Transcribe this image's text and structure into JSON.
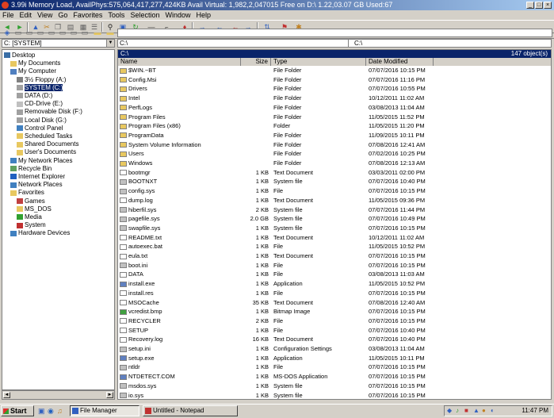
{
  "window": {
    "title": "3.99i Memory Load, AvailPhys:575,064,417,277,424KB Avail Virtual: 1,982,2,047015 Free on D:\\ 1.22,03.07 GB Used:67"
  },
  "menu": [
    "File",
    "Edit",
    "View",
    "Go",
    "Favorites",
    "Tools",
    "Selection",
    "Window",
    "Help"
  ],
  "drive_selector": {
    "value": "C: [SYSTEM]"
  },
  "path": {
    "left": "C:\\",
    "right": "C:\\"
  },
  "list_header": {
    "title": "C:\\",
    "count": "147 object(s)"
  },
  "columns": [
    "Name",
    "Size",
    "Type",
    "Date Modified"
  ],
  "tree": [
    {
      "label": "Desktop",
      "level": 0,
      "icon": "desktop-icon",
      "color": "#3a6ea5"
    },
    {
      "label": "My Documents",
      "level": 1,
      "icon": "folder-icon",
      "color": "#e8c860"
    },
    {
      "label": "My Computer",
      "level": 1,
      "icon": "computer-icon",
      "color": "#5080c0"
    },
    {
      "label": "3½ Floppy (A:)",
      "level": 2,
      "icon": "floppy-icon",
      "color": "#808080"
    },
    {
      "label": "SYSTEM (C:)",
      "level": 2,
      "icon": "drive-icon",
      "color": "#a0a0a0"
    },
    {
      "label": "DATA (D:)",
      "level": 2,
      "icon": "drive-icon",
      "color": "#a0a0a0"
    },
    {
      "label": "CD-Drive (E:)",
      "level": 2,
      "icon": "cd-drive-icon",
      "color": "#c0c0c0"
    },
    {
      "label": "Removable Disk (F:)",
      "level": 2,
      "icon": "drive-icon",
      "color": "#a0a0a0"
    },
    {
      "label": "Local Disk (G:)",
      "level": 2,
      "icon": "drive-icon",
      "color": "#a0a0a0"
    },
    {
      "label": "Control Panel",
      "level": 2,
      "icon": "control-panel-icon",
      "color": "#4080c0"
    },
    {
      "label": "Scheduled Tasks",
      "level": 2,
      "icon": "tasks-icon",
      "color": "#e8c860"
    },
    {
      "label": "Shared Documents",
      "level": 2,
      "icon": "folder-icon",
      "color": "#e8c860"
    },
    {
      "label": "User's Documents",
      "level": 2,
      "icon": "folder-icon",
      "color": "#e8c860"
    },
    {
      "label": "My Network Places",
      "level": 1,
      "icon": "network-icon",
      "color": "#4080c0"
    },
    {
      "label": "Recycle Bin",
      "level": 1,
      "icon": "recycle-bin-icon",
      "color": "#60a060"
    },
    {
      "label": "Internet Explorer",
      "level": 1,
      "icon": "ie-icon",
      "color": "#2060c0"
    },
    {
      "label": "Network Places",
      "level": 1,
      "icon": "network-icon",
      "color": "#4080c0"
    },
    {
      "label": "Favorites",
      "level": 1,
      "icon": "favorites-icon",
      "color": "#e8c860"
    },
    {
      "label": "Games",
      "level": 2,
      "icon": "games-icon",
      "color": "#c04040"
    },
    {
      "label": "MS_DOS",
      "level": 2,
      "icon": "folder-icon",
      "color": "#e8c860"
    },
    {
      "label": "Media",
      "level": 2,
      "icon": "media-icon",
      "color": "#30a030"
    },
    {
      "label": "System",
      "level": 2,
      "icon": "system-icon",
      "color": "#c03030"
    },
    {
      "label": "Hardware Devices",
      "level": 1,
      "icon": "hardware-icon",
      "color": "#4080c0"
    }
  ],
  "files": [
    {
      "name": "$WIN.~BT",
      "size": "",
      "type": "File Folder",
      "date": "07/07/2016 10:15 PM",
      "icon": "folder-icon",
      "color": "#e8c860"
    },
    {
      "name": "Config.Msi",
      "size": "",
      "type": "File Folder",
      "date": "07/07/2016 11:16 PM",
      "icon": "folder-icon",
      "color": "#e8c860"
    },
    {
      "name": "Drivers",
      "size": "",
      "type": "File Folder",
      "date": "07/07/2016 10:55 PM",
      "icon": "folder-icon",
      "color": "#e8c860"
    },
    {
      "name": "Intel",
      "size": "",
      "type": "File Folder",
      "date": "10/12/2011 11:02 AM",
      "icon": "folder-icon",
      "color": "#e8c860"
    },
    {
      "name": "PerfLogs",
      "size": "",
      "type": "File Folder",
      "date": "03/08/2013 11:04 AM",
      "icon": "folder-icon",
      "color": "#e8c860"
    },
    {
      "name": "Program Files",
      "size": "",
      "type": "File Folder",
      "date": "11/05/2015 11:52 PM",
      "icon": "folder-icon",
      "color": "#e8c860"
    },
    {
      "name": "Program Files (x86)",
      "size": "",
      "type": "Folder",
      "date": "11/05/2015 11:20 PM",
      "icon": "folder-icon",
      "color": "#e8c860"
    },
    {
      "name": "ProgramData",
      "size": "",
      "type": "File Folder",
      "date": "11/09/2015 10:11 PM",
      "icon": "folder-icon",
      "color": "#e8c860"
    },
    {
      "name": "System Volume Information",
      "size": "",
      "type": "File Folder",
      "date": "07/08/2016 12:41 AM",
      "icon": "folder-icon",
      "color": "#e8c860"
    },
    {
      "name": "Users",
      "size": "",
      "type": "File Folder",
      "date": "07/02/2016 10:25 PM",
      "icon": "folder-icon",
      "color": "#e8c860"
    },
    {
      "name": "Windows",
      "size": "",
      "type": "File Folder",
      "date": "07/08/2016 12:13 AM",
      "icon": "folder-icon",
      "color": "#e8c860"
    },
    {
      "name": "bootmgr",
      "size": "1 KB",
      "type": "Text Document",
      "date": "03/03/2011 02:00 PM",
      "icon": "file-icon",
      "color": "#ffffff"
    },
    {
      "name": "BOOTNXT",
      "size": "1 KB",
      "type": "System file",
      "date": "07/07/2016 10:40 PM",
      "icon": "sysfile-icon",
      "color": "#c0c0c0"
    },
    {
      "name": "config.sys",
      "size": "1 KB",
      "type": "File",
      "date": "07/07/2016 10:15 PM",
      "icon": "sysfile-icon",
      "color": "#c0c0c0"
    },
    {
      "name": "dump.log",
      "size": "1 KB",
      "type": "Text Document",
      "date": "11/05/2015 09:36 PM",
      "icon": "file-icon",
      "color": "#ffffff"
    },
    {
      "name": "hiberfil.sys",
      "size": "2 KB",
      "type": "System file",
      "date": "07/07/2016 11:44 PM",
      "icon": "sysfile-icon",
      "color": "#c0c0c0"
    },
    {
      "name": "pagefile.sys",
      "size": "2.0 GB",
      "type": "System file",
      "date": "07/07/2016 10:49 PM",
      "icon": "sysfile-icon",
      "color": "#c0c0c0"
    },
    {
      "name": "swapfile.sys",
      "size": "1 KB",
      "type": "System file",
      "date": "07/07/2016 10:15 PM",
      "icon": "sysfile-icon",
      "color": "#c0c0c0"
    },
    {
      "name": "README.txt",
      "size": "1 KB",
      "type": "Text Document",
      "date": "10/12/2011 11:02 AM",
      "icon": "file-icon",
      "color": "#ffffff"
    },
    {
      "name": "autoexec.bat",
      "size": "1 KB",
      "type": "File",
      "date": "11/05/2015 10:52 PM",
      "icon": "file-icon",
      "color": "#ffffff"
    },
    {
      "name": "eula.txt",
      "size": "1 KB",
      "type": "Text Document",
      "date": "07/07/2016 10:15 PM",
      "icon": "file-icon",
      "color": "#ffffff"
    },
    {
      "name": "boot.ini",
      "size": "1 KB",
      "type": "File",
      "date": "07/07/2016 10:15 PM",
      "icon": "sysfile-icon",
      "color": "#c0c0c0"
    },
    {
      "name": "DATA",
      "size": "1 KB",
      "type": "File",
      "date": "03/08/2013 11:03 AM",
      "icon": "file-icon",
      "color": "#ffffff"
    },
    {
      "name": "install.exe",
      "size": "1 KB",
      "type": "Application",
      "date": "11/05/2015 10:52 PM",
      "icon": "exe-icon",
      "color": "#6080c0"
    },
    {
      "name": "install.res",
      "size": "1 KB",
      "type": "File",
      "date": "07/07/2016 10:15 PM",
      "icon": "file-icon",
      "color": "#ffffff"
    },
    {
      "name": "MSOCache",
      "size": "35 KB",
      "type": "Text Document",
      "date": "07/08/2016 12:40 AM",
      "icon": "file-icon",
      "color": "#ffffff"
    },
    {
      "name": "vcredist.bmp",
      "size": "1 KB",
      "type": "Bitmap Image",
      "date": "07/07/2016 10:15 PM",
      "icon": "image-icon",
      "color": "#40a040"
    },
    {
      "name": "RECYCLER",
      "size": "2 KB",
      "type": "File",
      "date": "07/07/2016 10:15 PM",
      "icon": "file-icon",
      "color": "#ffffff"
    },
    {
      "name": "SETUP",
      "size": "1 KB",
      "type": "File",
      "date": "07/07/2016 10:40 PM",
      "icon": "file-icon",
      "color": "#ffffff"
    },
    {
      "name": "Recovery.log",
      "size": "16 KB",
      "type": "Text Document",
      "date": "07/07/2016 10:40 PM",
      "icon": "file-icon",
      "color": "#ffffff"
    },
    {
      "name": "setup.ini",
      "size": "1 KB",
      "type": "Configuration Settings",
      "date": "03/08/2013 11:04 AM",
      "icon": "sysfile-icon",
      "color": "#c0c0c0"
    },
    {
      "name": "setup.exe",
      "size": "1 KB",
      "type": "Application",
      "date": "11/05/2015 10:11 PM",
      "icon": "exe-icon",
      "color": "#6080c0"
    },
    {
      "name": "ntldr",
      "size": "1 KB",
      "type": "File",
      "date": "07/07/2016 10:15 PM",
      "icon": "sysfile-icon",
      "color": "#c0c0c0"
    },
    {
      "name": "NTDETECT.COM",
      "size": "1 KB",
      "type": "MS-DOS Application",
      "date": "07/07/2016 10:15 PM",
      "icon": "exe-icon",
      "color": "#6080c0"
    },
    {
      "name": "msdos.sys",
      "size": "1 KB",
      "type": "System file",
      "date": "07/07/2016 10:15 PM",
      "icon": "sysfile-icon",
      "color": "#c0c0c0"
    },
    {
      "name": "io.sys",
      "size": "1 KB",
      "type": "System file",
      "date": "07/07/2016 10:15 PM",
      "icon": "sysfile-icon",
      "color": "#c0c0c0"
    }
  ],
  "taskbar": {
    "start": "Start",
    "tasks": [
      {
        "label": "File Manager",
        "active": true,
        "icon": "file-manager-icon",
        "color": "#3060c0"
      },
      {
        "label": "Untitled - Notepad",
        "active": false,
        "icon": "notepad-icon",
        "color": "#c03030"
      }
    ],
    "clock": "11:47 PM"
  },
  "colors": {
    "titlebar": "#0a246a",
    "selection": "#0a246a",
    "window": "#d4d0c8"
  }
}
